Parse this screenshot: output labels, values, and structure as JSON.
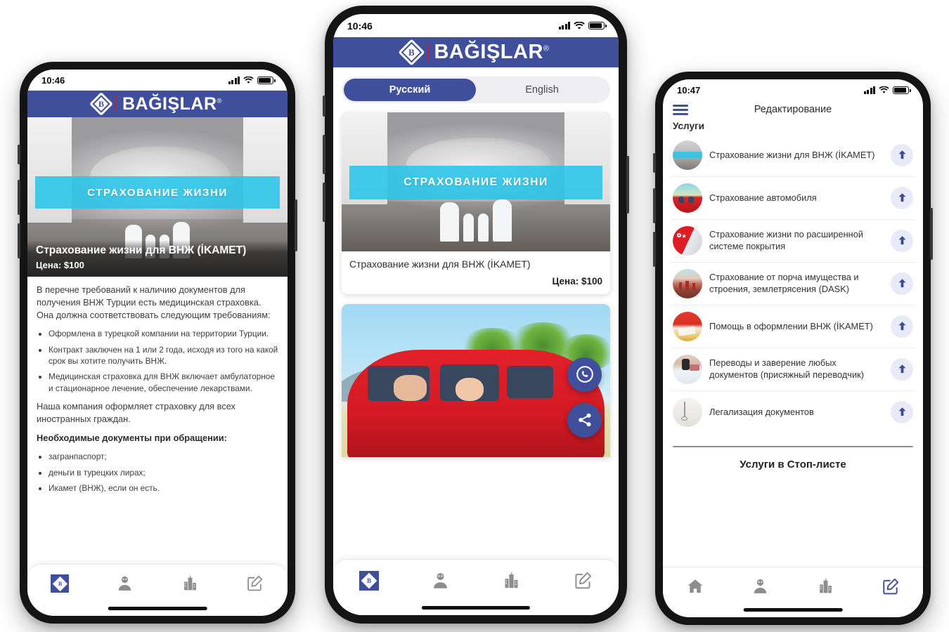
{
  "app": {
    "brand_name": "BAĞIŞLAR",
    "brand_mark": "B",
    "registered_mark": "®",
    "brand_color": "#3f4f9c",
    "accent_cyan": "#29c5e8",
    "accent_red": "#b9243a"
  },
  "phone1": {
    "status": {
      "time": "10:46"
    },
    "hero": {
      "banner_text": "СТРАХОВАНИЕ ЖИЗНИ",
      "title": "Страхование жизни для ВНЖ (İKAMET)",
      "price": "Цена: $100"
    },
    "article": {
      "intro": "В перечне требований к наличию документов для получения ВНЖ Турции есть медицинская страховка. Она должна соответствовать следующим требованиям:",
      "bullets": [
        "Оформлена в турецкой компании на территории Турции.",
        "Контракт заключен на 1 или 2 года, исходя из того на какой срок вы хотите получить ВНЖ.",
        "Медицинская страховка для ВНЖ включает амбулаторное и стационарное лечение, обеспечение лекарствами."
      ],
      "paragraph2": "Наша компания оформляет страховку для всех иностранных граждан.",
      "docs_heading": "Необходимые документы при обращении:",
      "docs": [
        "загранпаспорт;",
        "деньги в турецких лирах;",
        "Икамет (ВНЖ), если он есть."
      ]
    },
    "tabs": [
      {
        "name": "brand-logo-tab",
        "icon": "diamond-logo-icon",
        "active": true
      },
      {
        "name": "profile-tab",
        "icon": "person-icon",
        "active": false
      },
      {
        "name": "company-tab",
        "icon": "buildings-icon",
        "active": false
      },
      {
        "name": "edit-tab",
        "icon": "edit-square-icon",
        "active": false
      }
    ]
  },
  "phone2": {
    "status": {
      "time": "10:46"
    },
    "language": {
      "options": [
        "Русский",
        "English"
      ],
      "selected": "Русский"
    },
    "card1": {
      "banner_text": "СТРАХОВАНИЕ ЖИЗНИ",
      "title": "Страхование жизни для ВНЖ (İKAMET)",
      "price": "Цена: $100"
    },
    "card2": {
      "alt": "family-in-red-car-photo"
    },
    "fabs": [
      {
        "name": "whatsapp-call-button",
        "icon": "phone-circle-icon"
      },
      {
        "name": "share-button",
        "icon": "share-icon"
      }
    ],
    "tabs": [
      {
        "name": "brand-logo-tab",
        "icon": "diamond-logo-icon",
        "active": true
      },
      {
        "name": "profile-tab",
        "icon": "person-icon",
        "active": false
      },
      {
        "name": "company-tab",
        "icon": "buildings-icon",
        "active": false
      },
      {
        "name": "edit-tab",
        "icon": "edit-square-icon",
        "active": false
      }
    ]
  },
  "phone3": {
    "status": {
      "time": "10:47"
    },
    "nav": {
      "title": "Редактирование",
      "menu_icon": "hamburger-icon"
    },
    "section_title": "Услуги",
    "services": [
      {
        "label": "Страхование жизни для ВНЖ (İKAMET)",
        "thumb": "hands-family-thumb",
        "action": "publish-icon"
      },
      {
        "label": "Страхование автомобиля",
        "thumb": "red-car-thumb",
        "action": "publish-icon"
      },
      {
        "label": "Страхование жизни по расширенной системе покрытия",
        "thumb": "turkish-flag-doctor-thumb",
        "action": "publish-icon"
      },
      {
        "label": "Страхование от порча имущества и строения, землетрясения (DASK)",
        "thumb": "earthquake-house-thumb",
        "action": "publish-icon"
      },
      {
        "label": "Помощь в оформлении ВНЖ (İKAMET)",
        "thumb": "residence-permit-thumb",
        "action": "publish-icon"
      },
      {
        "label": "Переводы и заверение любых документов (присяжный переводчик)",
        "thumb": "translation-stamp-thumb",
        "action": "publish-icon"
      },
      {
        "label": "Легализация документов",
        "thumb": "legalization-doc-thumb",
        "action": "publish-icon"
      }
    ],
    "stop_list_title": "Услуги в Стоп-листе",
    "tabs": [
      {
        "name": "home-tab",
        "icon": "home-icon",
        "active": false
      },
      {
        "name": "profile-tab",
        "icon": "person-icon",
        "active": false
      },
      {
        "name": "company-tab",
        "icon": "buildings-icon",
        "active": false
      },
      {
        "name": "edit-tab",
        "icon": "edit-square-icon",
        "active": true
      }
    ]
  }
}
